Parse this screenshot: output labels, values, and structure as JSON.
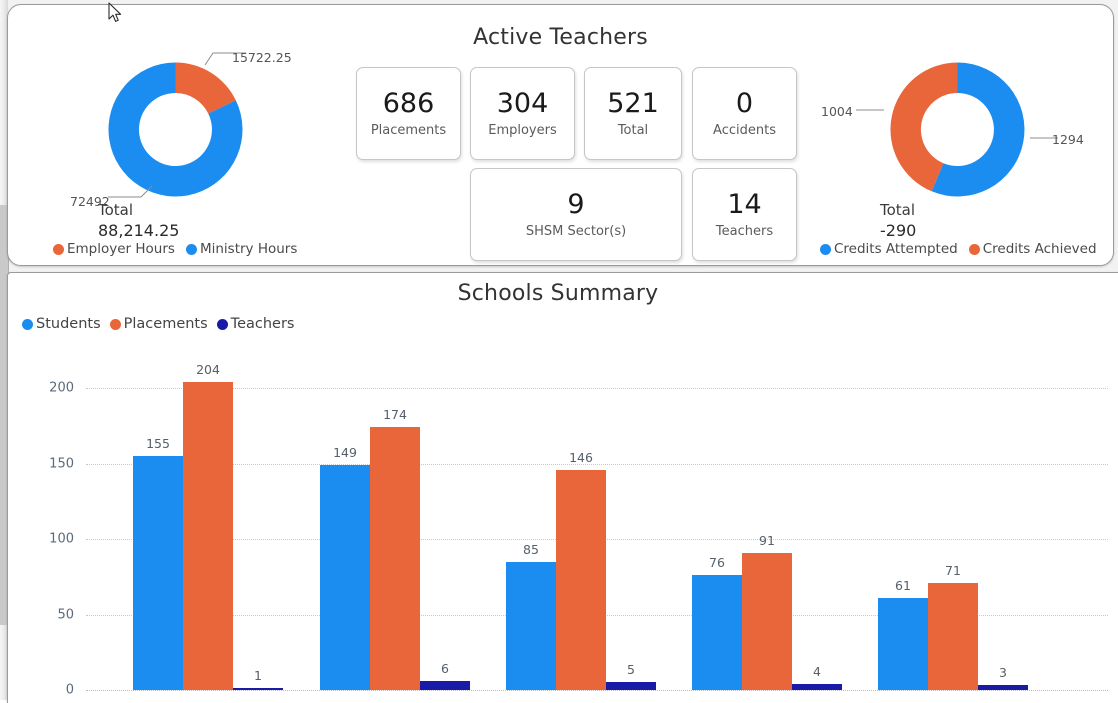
{
  "top_panel": {
    "title": "Active Teachers",
    "left_donut": {
      "center_label": "Total",
      "center_value": "88,214.25",
      "callouts": [
        {
          "text": "15722.25",
          "series": "Employer Hours"
        },
        {
          "text": "72492",
          "series": "Ministry Hours"
        }
      ],
      "legend": [
        {
          "label": "Employer Hours",
          "color": "#e8663a"
        },
        {
          "label": "Ministry Hours",
          "color": "#1b8df0"
        }
      ],
      "slices": [
        {
          "name": "Employer Hours",
          "value": 15722.25,
          "color": "#e8663a"
        },
        {
          "name": "Ministry Hours",
          "value": 72492,
          "color": "#1b8df0"
        }
      ]
    },
    "right_donut": {
      "center_label": "Total",
      "center_value": "-290",
      "callouts": [
        {
          "text": "1004",
          "series": "Credits Achieved"
        },
        {
          "text": "1294",
          "series": "Credits Attempted"
        }
      ],
      "legend": [
        {
          "label": "Credits Attempted",
          "color": "#1b8df0"
        },
        {
          "label": "Credits Achieved",
          "color": "#e8663a"
        }
      ],
      "slices": [
        {
          "name": "Credits Attempted",
          "value": 1294,
          "color": "#1b8df0"
        },
        {
          "name": "Credits Achieved",
          "value": 1004,
          "color": "#e8663a"
        }
      ]
    },
    "kpis": [
      {
        "value": "686",
        "caption": "Placements"
      },
      {
        "value": "304",
        "caption": "Employers"
      },
      {
        "value": "521",
        "caption": "Total"
      },
      {
        "value": "0",
        "caption": "Accidents"
      },
      {
        "value": "9",
        "caption": "SHSM Sector(s)"
      },
      {
        "value": "14",
        "caption": "Teachers"
      }
    ]
  },
  "bottom_panel": {
    "title": "Schools Summary"
  },
  "chart_data": {
    "type": "bar",
    "title": "Schools Summary",
    "xlabel": "",
    "ylabel": "",
    "ylim": [
      0,
      215
    ],
    "yticks": [
      0,
      50,
      100,
      150,
      200
    ],
    "grid": true,
    "legend_position": "top-left",
    "categories": [
      "",
      "",
      "",
      "",
      ""
    ],
    "series": [
      {
        "name": "Students",
        "color": "#1b8df0",
        "values": [
          155,
          149,
          85,
          76,
          61
        ]
      },
      {
        "name": "Placements",
        "color": "#e8663a",
        "values": [
          204,
          174,
          146,
          91,
          71
        ]
      },
      {
        "name": "Teachers",
        "color": "#1a1aa8",
        "values": [
          1,
          6,
          5,
          4,
          3
        ]
      }
    ]
  },
  "colors": {
    "blue": "#1b8df0",
    "orange": "#e8663a",
    "navy": "#1a1aa8",
    "panel_border": "#9a9a9a",
    "text": "#3a3a3a"
  }
}
